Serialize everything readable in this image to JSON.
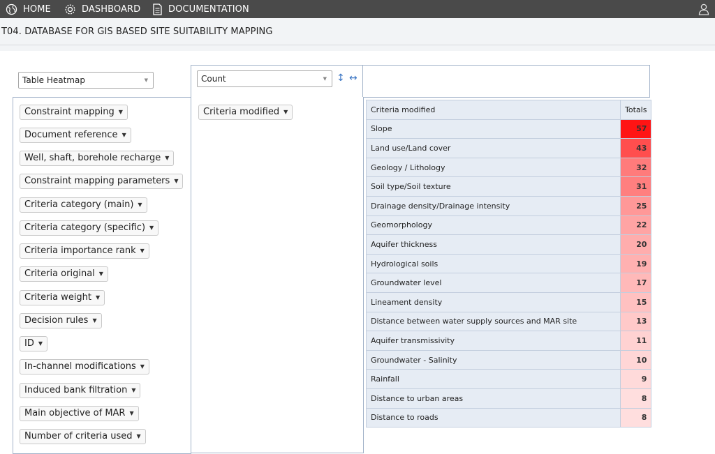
{
  "nav": {
    "home": "HOME",
    "dashboard": "DASHBOARD",
    "documentation": "DOCUMENTATION",
    "icons": {
      "home": "globe-icon",
      "dashboard": "gear-icon",
      "documentation": "document-icon",
      "user": "user-icon"
    }
  },
  "header": {
    "title": "T04. DATABASE FOR GIS BASED SITE SUITABILITY MAPPING"
  },
  "controls": {
    "renderer": "Table Heatmap",
    "aggregator": "Count",
    "sort_rows_icon": "↕",
    "sort_cols_icon": "↔"
  },
  "attributes": [
    "Constraint mapping",
    "Document reference",
    "Well, shaft, borehole recharge",
    "Constraint mapping parameters",
    "Criteria category (main)",
    "Criteria category (specific)",
    "Criteria importance rank",
    "Criteria original",
    "Criteria weight",
    "Decision rules",
    "ID",
    "In-channel modifications",
    "Induced bank filtration",
    "Main objective of MAR",
    "Number of criteria used"
  ],
  "row_attribute": "Criteria modified",
  "table": {
    "header_label": "Criteria modified",
    "header_total": "Totals",
    "heat_color": "#ff0000",
    "rows": [
      {
        "label": "Slope",
        "value": 57
      },
      {
        "label": "Land use/Land cover",
        "value": 43
      },
      {
        "label": "Geology / Lithology",
        "value": 32
      },
      {
        "label": "Soil type/Soil texture",
        "value": 31
      },
      {
        "label": "Drainage density/Drainage intensity",
        "value": 25
      },
      {
        "label": "Geomorphology",
        "value": 22
      },
      {
        "label": "Aquifer thickness",
        "value": 20
      },
      {
        "label": "Hydrological soils",
        "value": 19
      },
      {
        "label": "Groundwater level",
        "value": 17
      },
      {
        "label": "Lineament density",
        "value": 15
      },
      {
        "label": "Distance between water supply sources and MAR site",
        "value": 13
      },
      {
        "label": "Aquifer transmissivity",
        "value": 11
      },
      {
        "label": "Groundwater - Salinity",
        "value": 10
      },
      {
        "label": "Rainfall",
        "value": 9
      },
      {
        "label": "Distance to urban areas",
        "value": 8
      },
      {
        "label": "Distance to roads",
        "value": 8
      }
    ]
  }
}
